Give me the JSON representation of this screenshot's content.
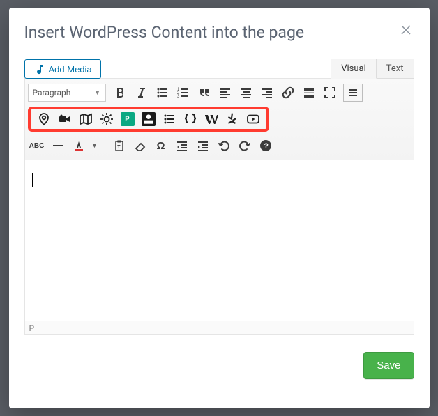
{
  "modal": {
    "title": "Insert WordPress Content into the page",
    "close_label": "Close"
  },
  "media": {
    "add_label": "Add Media"
  },
  "tabs": {
    "visual": "Visual",
    "text": "Text",
    "active": "visual"
  },
  "toolbar": {
    "paragraph_label": "Paragraph",
    "row1": [
      "bold",
      "italic",
      "bullet-list",
      "number-list",
      "blockquote",
      "align-left",
      "align-center",
      "align-right",
      "link",
      "read-more",
      "fullscreen",
      "toolbar-toggle"
    ],
    "row2_custom": [
      "map-pin",
      "camera-video",
      "map",
      "sun",
      "pexels",
      "pixabay",
      "bullet-indent",
      "braces",
      "wikipedia",
      "yelp",
      "youtube"
    ],
    "row3": [
      "strikethrough",
      "hr",
      "text-color",
      "color-dropdown",
      "paste-text",
      "clear-format",
      "special-char",
      "outdent",
      "indent",
      "undo",
      "redo",
      "help"
    ]
  },
  "path": {
    "value": "P"
  },
  "footer": {
    "save_label": "Save"
  }
}
